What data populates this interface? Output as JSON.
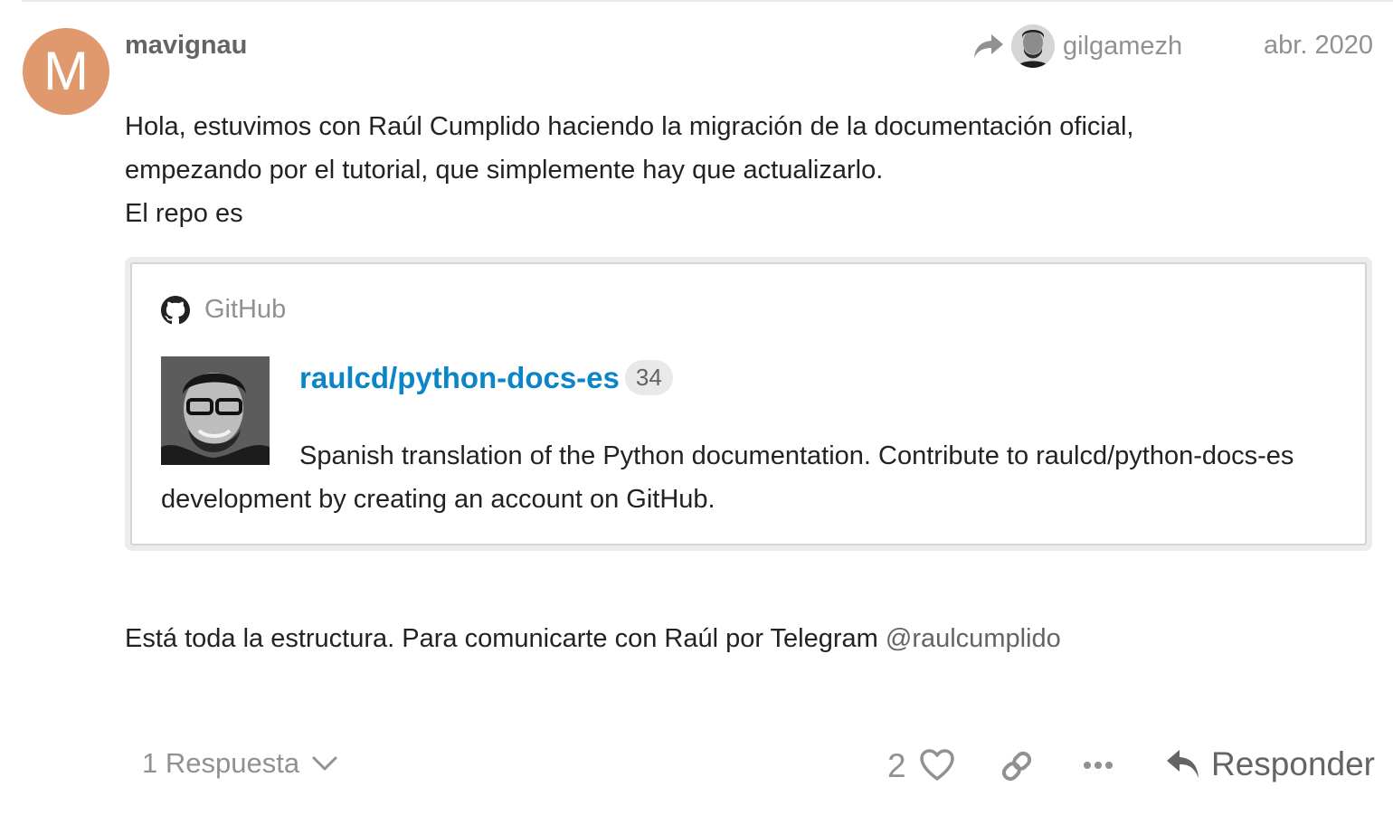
{
  "post": {
    "author": {
      "avatar_letter": "M",
      "avatar_color": "#e0996d",
      "username": "mavignau"
    },
    "reply_to": {
      "share_icon": "share-arrow-icon",
      "username": "gilgamezh"
    },
    "date": "abr. 2020",
    "body": {
      "line1": "Hola, estuvimos con Raúl Cumplido haciendo la migración de la documentación oficial,",
      "line2": "empezando por el tutorial, que simplemente hay que actualizarlo.",
      "line3": "El repo es"
    },
    "onebox": {
      "source_icon": "github-icon",
      "source": "GitHub",
      "repo_title": "raulcd/python-docs-es",
      "repo_count": "34",
      "description": "Spanish translation of the Python documentation. Contribute to raulcd/python-docs-es development by creating an account on GitHub."
    },
    "footer_text": {
      "text": "Está toda la estructura. Para comunicarte con Raúl por Telegram ",
      "mention": "@raulcumplido"
    },
    "actions": {
      "replies_label": "1 Respuesta",
      "replies_icon": "chevron-down-icon",
      "like_count": "2",
      "like_icon": "heart-icon",
      "link_icon": "link-icon",
      "more_icon": "ellipsis-icon",
      "reply_icon": "reply-icon",
      "reply_label": "Responder"
    },
    "colors": {
      "link_blue": "#0a85c8",
      "muted_text": "#919191",
      "body_text": "#222222"
    }
  }
}
